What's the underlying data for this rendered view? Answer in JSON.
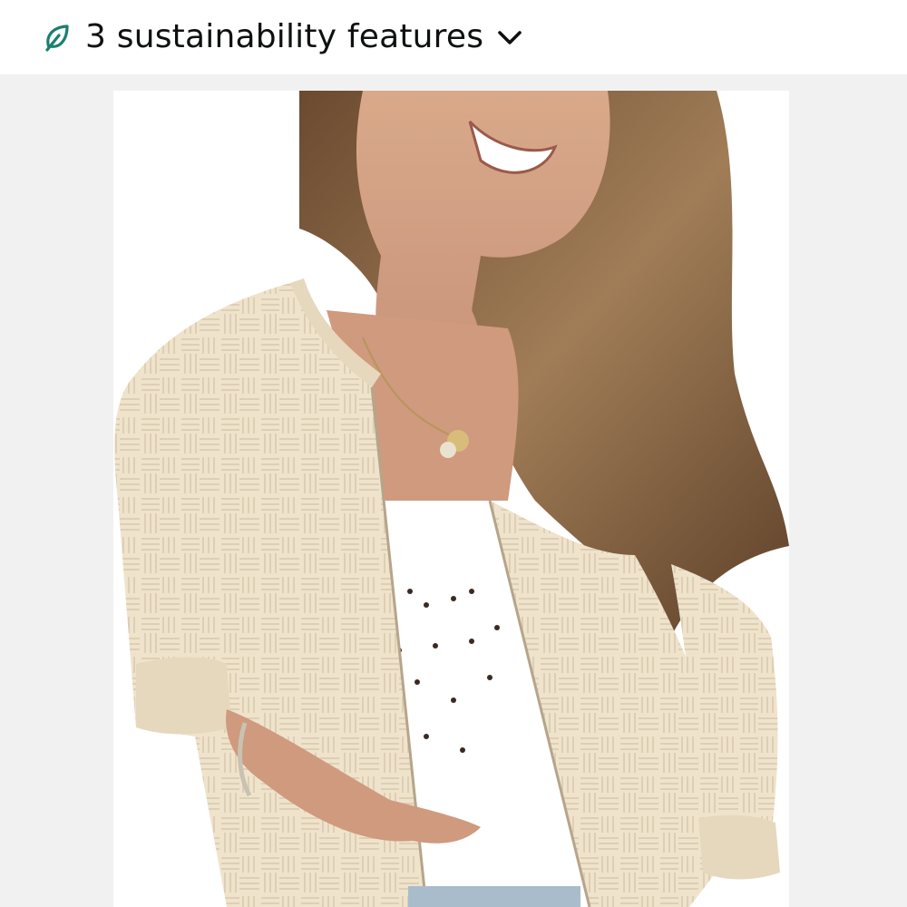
{
  "sustainability": {
    "label": "3 sustainability features",
    "leaf_icon": "leaf-icon",
    "toggle_icon": "chevron-down-icon",
    "accent_color": "#1a7f6f"
  },
  "product_image": {
    "background_color": "#f2f1f2",
    "jacket_color": "#efe3cc",
    "top_color": "#ffffff",
    "hair_color": "#8a6746"
  }
}
